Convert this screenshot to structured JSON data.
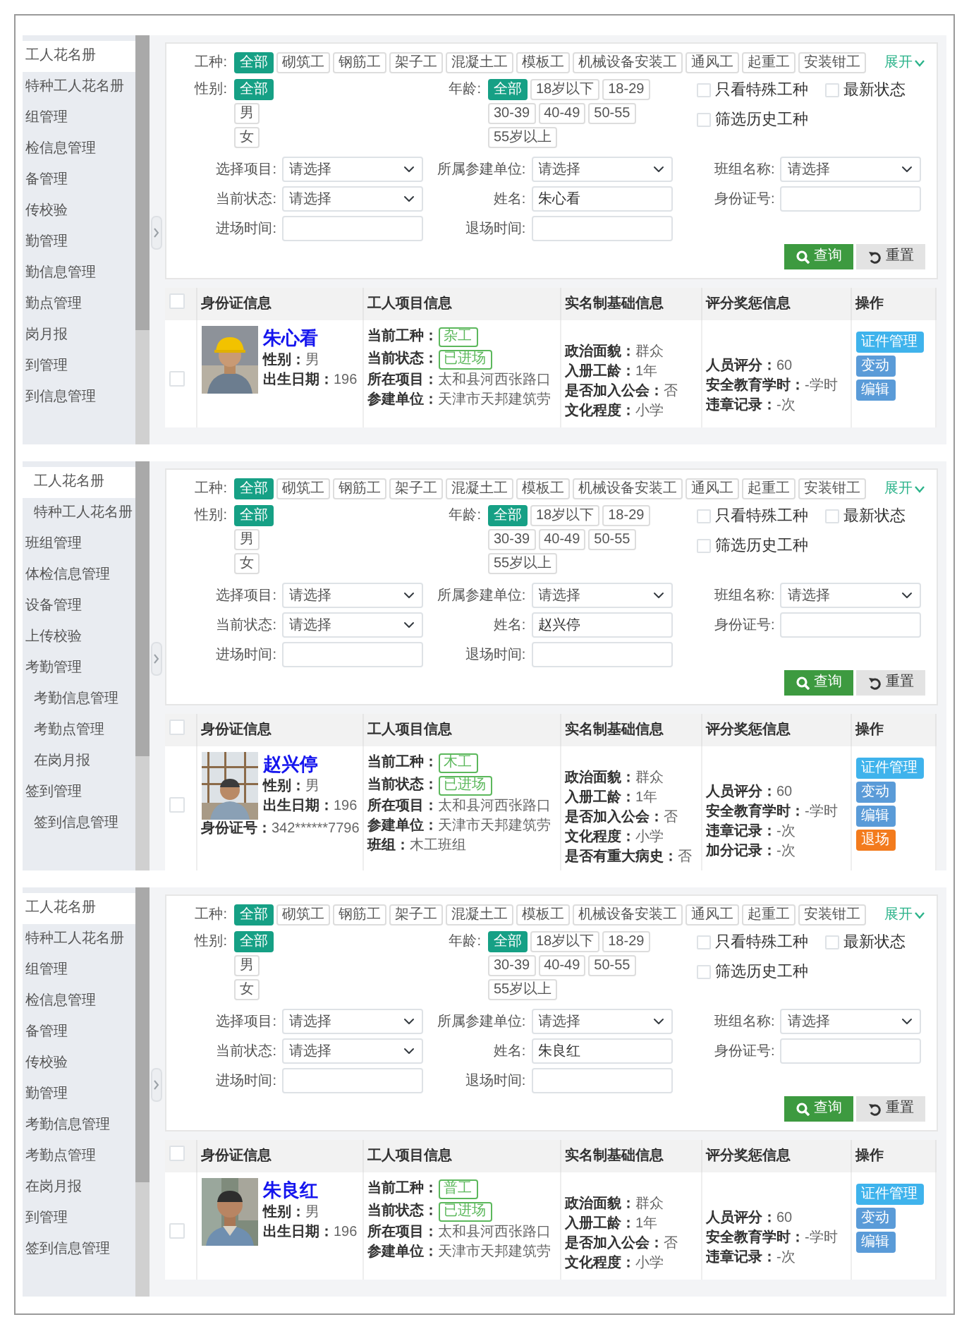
{
  "panels": [
    {
      "sidebar": {
        "items": [
          {
            "label": "工人花名册",
            "kind": "item",
            "selected": true
          },
          {
            "label": "特种工人花名册",
            "kind": "item",
            "selected": false
          },
          {
            "label": "组管理",
            "kind": "item",
            "selected": false
          },
          {
            "label": "检信息管理",
            "kind": "item",
            "selected": false
          },
          {
            "label": "备管理",
            "kind": "item",
            "selected": false
          },
          {
            "label": "传校验",
            "kind": "item",
            "selected": false
          },
          {
            "label": "勤管理",
            "kind": "item",
            "selected": false
          },
          {
            "label": "勤信息管理",
            "kind": "item",
            "selected": false
          },
          {
            "label": "勤点管理",
            "kind": "item",
            "selected": false
          },
          {
            "label": "岗月报",
            "kind": "item",
            "selected": false
          },
          {
            "label": "到管理",
            "kind": "item",
            "selected": false
          },
          {
            "label": "到信息管理",
            "kind": "item",
            "selected": false
          }
        ]
      },
      "filter": {
        "trade": {
          "label": "工种:",
          "options": [
            {
              "label": "全部",
              "selected": true
            },
            {
              "label": "砌筑工",
              "selected": false
            },
            {
              "label": "钢筋工",
              "selected": false
            },
            {
              "label": "架子工",
              "selected": false
            },
            {
              "label": "混凝土工",
              "selected": false
            },
            {
              "label": "模板工",
              "selected": false
            },
            {
              "label": "机械设备安装工",
              "selected": false
            },
            {
              "label": "通风工",
              "selected": false
            },
            {
              "label": "起重工",
              "selected": false
            },
            {
              "label": "安装钳工",
              "selected": false
            }
          ]
        },
        "expand": "展开",
        "gender": {
          "label": "性别:",
          "options": [
            {
              "label": "全部",
              "selected": true
            },
            {
              "label": "男",
              "selected": false
            },
            {
              "label": "女",
              "selected": false
            }
          ]
        },
        "age": {
          "label": "年龄:",
          "options": [
            {
              "label": "全部",
              "selected": true
            },
            {
              "label": "18岁以下",
              "selected": false
            },
            {
              "label": "18-29",
              "selected": false
            },
            {
              "label": "30-39",
              "selected": false
            },
            {
              "label": "40-49",
              "selected": false
            },
            {
              "label": "50-55",
              "selected": false
            },
            {
              "label": "55岁以上",
              "selected": false
            }
          ]
        },
        "checks": [
          {
            "label": "只看特殊工种",
            "checked": false
          },
          {
            "label": "最新状态",
            "checked": false
          },
          {
            "label": "筛选历史工种",
            "checked": false
          }
        ],
        "fields": [
          {
            "label": "选择项目:",
            "kind": "select",
            "value": "请选择"
          },
          {
            "label": "所属参建单位:",
            "kind": "select",
            "value": "请选择"
          },
          {
            "label": "班组名称:",
            "kind": "select",
            "value": "请选择"
          },
          {
            "label": "当前状态:",
            "kind": "select",
            "value": "请选择"
          },
          {
            "label": "姓名:",
            "kind": "input",
            "value": "朱心看"
          },
          {
            "label": "身份证号:",
            "kind": "input"
          },
          {
            "label": "进场时间:",
            "kind": "input"
          },
          {
            "label": "退场时间:",
            "kind": "input"
          }
        ],
        "buttons": [
          {
            "label": "查询",
            "kind": "search"
          },
          {
            "label": "重置",
            "kind": "reset"
          }
        ]
      },
      "table": {
        "header_checked": false,
        "columns": [
          "身份证信息",
          "工人项目信息",
          "实名制基础信息",
          "评分奖惩信息",
          "操作"
        ],
        "rows": [
          {
            "checked": false,
            "photo": {
              "kind": "picture"
            },
            "name": "朱心看",
            "details": [
              {
                "label": "性别：",
                "value": "男"
              },
              {
                "label": "出生日期：",
                "value": "196"
              }
            ],
            "project": [
              {
                "kind": "tag",
                "label": "当前工种：",
                "value": "杂工"
              },
              {
                "kind": "tag",
                "label": "当前状态：",
                "value": "已进场"
              },
              {
                "kind": "text",
                "label": "所在项目：",
                "value": "太和县河西张路口"
              },
              {
                "kind": "text",
                "label": "参建单位：",
                "value": "天津市天邦建筑劳"
              }
            ],
            "basic": [
              {
                "label": "政治面貌：",
                "value": "群众"
              },
              {
                "label": "入册工龄：",
                "value": "1年"
              },
              {
                "label": "是否加入公会：",
                "value": "否"
              },
              {
                "label": "文化程度：",
                "value": "小学"
              }
            ],
            "scores": [
              {
                "label": "人员评分：",
                "value": "60"
              },
              {
                "label": "安全教育学时：",
                "value": "-学时"
              },
              {
                "label": "违章记录：",
                "value": "-次"
              }
            ],
            "actions": [
              {
                "label": "证件管理",
                "kind": "info"
              },
              {
                "label": "变动",
                "kind": "primary"
              },
              {
                "label": "编辑",
                "kind": "primary"
              }
            ]
          }
        ]
      }
    },
    {
      "sidebar": {
        "items": [
          {
            "label": "工人花名册",
            "kind": "subitem",
            "selected": true
          },
          {
            "label": "特种工人花名册",
            "kind": "subitem",
            "selected": false
          },
          {
            "label": "班组管理",
            "kind": "item",
            "selected": false
          },
          {
            "label": "体检信息管理",
            "kind": "item",
            "selected": false
          },
          {
            "label": "设备管理",
            "kind": "item",
            "selected": false
          },
          {
            "label": "上传校验",
            "kind": "item",
            "selected": false
          },
          {
            "label": "考勤管理",
            "kind": "item",
            "selected": false
          },
          {
            "label": "考勤信息管理",
            "kind": "subitem",
            "selected": false
          },
          {
            "label": "考勤点管理",
            "kind": "subitem",
            "selected": false
          },
          {
            "label": "在岗月报",
            "kind": "subitem",
            "selected": false
          },
          {
            "label": "签到管理",
            "kind": "item",
            "selected": false
          },
          {
            "label": "签到信息管理",
            "kind": "subitem",
            "selected": false
          }
        ]
      },
      "filter": {
        "trade": {
          "label": "工种:",
          "options": [
            {
              "label": "全部",
              "selected": true
            },
            {
              "label": "砌筑工",
              "selected": false
            },
            {
              "label": "钢筋工",
              "selected": false
            },
            {
              "label": "架子工",
              "selected": false
            },
            {
              "label": "混凝土工",
              "selected": false
            },
            {
              "label": "模板工",
              "selected": false
            },
            {
              "label": "机械设备安装工",
              "selected": false
            },
            {
              "label": "通风工",
              "selected": false
            },
            {
              "label": "起重工",
              "selected": false
            },
            {
              "label": "安装钳工",
              "selected": false
            }
          ]
        },
        "expand": "展开",
        "gender": {
          "label": "性别:",
          "options": [
            {
              "label": "全部",
              "selected": true
            },
            {
              "label": "男",
              "selected": false
            },
            {
              "label": "女",
              "selected": false
            }
          ]
        },
        "age": {
          "label": "年龄:",
          "options": [
            {
              "label": "全部",
              "selected": true
            },
            {
              "label": "18岁以下",
              "selected": false
            },
            {
              "label": "18-29",
              "selected": false
            },
            {
              "label": "30-39",
              "selected": false
            },
            {
              "label": "40-49",
              "selected": false
            },
            {
              "label": "50-55",
              "selected": false
            },
            {
              "label": "55岁以上",
              "selected": false
            }
          ]
        },
        "checks": [
          {
            "label": "只看特殊工种",
            "checked": false
          },
          {
            "label": "最新状态",
            "checked": false
          },
          {
            "label": "筛选历史工种",
            "checked": false
          }
        ],
        "fields": [
          {
            "label": "选择项目:",
            "kind": "select",
            "value": "请选择"
          },
          {
            "label": "所属参建单位:",
            "kind": "select",
            "value": "请选择"
          },
          {
            "label": "班组名称:",
            "kind": "select",
            "value": "请选择"
          },
          {
            "label": "当前状态:",
            "kind": "select",
            "value": "请选择"
          },
          {
            "label": "姓名:",
            "kind": "input",
            "value": "赵兴停"
          },
          {
            "label": "身份证号:",
            "kind": "input"
          },
          {
            "label": "进场时间:",
            "kind": "input"
          },
          {
            "label": "退场时间:",
            "kind": "input"
          }
        ],
        "buttons": [
          {
            "label": "查询",
            "kind": "search"
          },
          {
            "label": "重置",
            "kind": "reset"
          }
        ]
      },
      "table": {
        "header_checked": false,
        "columns": [
          "身份证信息",
          "工人项目信息",
          "实名制基础信息",
          "评分奖惩信息",
          "操作"
        ],
        "rows": [
          {
            "checked": false,
            "photo": {
              "kind": "picture"
            },
            "name": "赵兴停",
            "details": [
              {
                "label": "性别：",
                "value": "男"
              },
              {
                "label": "出生日期：",
                "value": "196"
              }
            ],
            "below": [
              {
                "label": "身份证号：",
                "value": "342******7796"
              }
            ],
            "project": [
              {
                "kind": "tag",
                "label": "当前工种：",
                "value": "木工"
              },
              {
                "kind": "tag",
                "label": "当前状态：",
                "value": "已进场"
              },
              {
                "kind": "text",
                "label": "所在项目：",
                "value": "太和县河西张路口"
              },
              {
                "kind": "text",
                "label": "参建单位：",
                "value": "天津市天邦建筑劳"
              },
              {
                "kind": "text",
                "label": "班组：",
                "value": "木工班组"
              }
            ],
            "basic": [
              {
                "label": "政治面貌：",
                "value": "群众"
              },
              {
                "label": "入册工龄：",
                "value": "1年"
              },
              {
                "label": "是否加入公会：",
                "value": "否"
              },
              {
                "label": "文化程度：",
                "value": "小学"
              },
              {
                "label": "是否有重大病史：",
                "value": "否"
              }
            ],
            "scores": [
              {
                "label": "人员评分：",
                "value": "60"
              },
              {
                "label": "安全教育学时：",
                "value": "-学时"
              },
              {
                "label": "违章记录：",
                "value": "-次"
              },
              {
                "label": "加分记录：",
                "value": "-次"
              }
            ],
            "actions": [
              {
                "label": "证件管理",
                "kind": "info"
              },
              {
                "label": "变动",
                "kind": "primary"
              },
              {
                "label": "编辑",
                "kind": "primary"
              },
              {
                "label": "退场",
                "kind": "warning"
              }
            ]
          }
        ]
      }
    },
    {
      "sidebar": {
        "items": [
          {
            "label": "工人花名册",
            "kind": "item",
            "selected": true
          },
          {
            "label": "特种工人花名册",
            "kind": "item",
            "selected": false
          },
          {
            "label": "组管理",
            "kind": "item",
            "selected": false
          },
          {
            "label": "检信息管理",
            "kind": "item",
            "selected": false
          },
          {
            "label": "备管理",
            "kind": "item",
            "selected": false
          },
          {
            "label": "传校验",
            "kind": "item",
            "selected": false
          },
          {
            "label": "勤管理",
            "kind": "item",
            "selected": false
          },
          {
            "label": "考勤信息管理",
            "kind": "item",
            "selected": false
          },
          {
            "label": "考勤点管理",
            "kind": "item",
            "selected": false
          },
          {
            "label": "在岗月报",
            "kind": "item",
            "selected": false
          },
          {
            "label": "到管理",
            "kind": "item",
            "selected": false
          },
          {
            "label": "签到信息管理",
            "kind": "item",
            "selected": false
          }
        ]
      },
      "filter": {
        "trade": {
          "label": "工种:",
          "options": [
            {
              "label": "全部",
              "selected": true
            },
            {
              "label": "砌筑工",
              "selected": false
            },
            {
              "label": "钢筋工",
              "selected": false
            },
            {
              "label": "架子工",
              "selected": false
            },
            {
              "label": "混凝土工",
              "selected": false
            },
            {
              "label": "模板工",
              "selected": false
            },
            {
              "label": "机械设备安装工",
              "selected": false
            },
            {
              "label": "通风工",
              "selected": false
            },
            {
              "label": "起重工",
              "selected": false
            },
            {
              "label": "安装钳工",
              "selected": false
            }
          ]
        },
        "expand": "展开",
        "gender": {
          "label": "性别:",
          "options": [
            {
              "label": "全部",
              "selected": true
            },
            {
              "label": "男",
              "selected": false
            },
            {
              "label": "女",
              "selected": false
            }
          ]
        },
        "age": {
          "label": "年龄:",
          "options": [
            {
              "label": "全部",
              "selected": true
            },
            {
              "label": "18岁以下",
              "selected": false
            },
            {
              "label": "18-29",
              "selected": false
            },
            {
              "label": "30-39",
              "selected": false
            },
            {
              "label": "40-49",
              "selected": false
            },
            {
              "label": "50-55",
              "selected": false
            },
            {
              "label": "55岁以上",
              "selected": false
            }
          ]
        },
        "checks": [
          {
            "label": "只看特殊工种",
            "checked": false
          },
          {
            "label": "最新状态",
            "checked": false
          },
          {
            "label": "筛选历史工种",
            "checked": false
          }
        ],
        "fields": [
          {
            "label": "选择项目:",
            "kind": "select",
            "value": "请选择"
          },
          {
            "label": "所属参建单位:",
            "kind": "select",
            "value": "请选择"
          },
          {
            "label": "班组名称:",
            "kind": "select",
            "value": "请选择"
          },
          {
            "label": "当前状态:",
            "kind": "select",
            "value": "请选择"
          },
          {
            "label": "姓名:",
            "kind": "input",
            "value": "朱良红"
          },
          {
            "label": "身份证号:",
            "kind": "input"
          },
          {
            "label": "进场时间:",
            "kind": "input"
          },
          {
            "label": "退场时间:",
            "kind": "input"
          }
        ],
        "buttons": [
          {
            "label": "查询",
            "kind": "search"
          },
          {
            "label": "重置",
            "kind": "reset"
          }
        ]
      },
      "table": {
        "header_checked": false,
        "columns": [
          "身份证信息",
          "工人项目信息",
          "实名制基础信息",
          "评分奖惩信息",
          "操作"
        ],
        "rows": [
          {
            "checked": false,
            "photo": {
              "kind": "picture"
            },
            "name": "朱良红",
            "details": [
              {
                "label": "性别：",
                "value": "男"
              },
              {
                "label": "出生日期：",
                "value": "196"
              }
            ],
            "project": [
              {
                "kind": "tag",
                "label": "当前工种：",
                "value": "普工"
              },
              {
                "kind": "tag",
                "label": "当前状态：",
                "value": "已进场"
              },
              {
                "kind": "text",
                "label": "所在项目：",
                "value": "太和县河西张路口"
              },
              {
                "kind": "text",
                "label": "参建单位：",
                "value": "天津市天邦建筑劳"
              }
            ],
            "basic": [
              {
                "label": "政治面貌：",
                "value": "群众"
              },
              {
                "label": "入册工龄：",
                "value": "1年"
              },
              {
                "label": "是否加入公会：",
                "value": "否"
              },
              {
                "label": "文化程度：",
                "value": "小学"
              }
            ],
            "scores": [
              {
                "label": "人员评分：",
                "value": "60"
              },
              {
                "label": "安全教育学时：",
                "value": "-学时"
              },
              {
                "label": "违章记录：",
                "value": "-次"
              }
            ],
            "actions": [
              {
                "label": "证件管理",
                "kind": "info"
              },
              {
                "label": "变动",
                "kind": "primary"
              },
              {
                "label": "编辑",
                "kind": "primary"
              }
            ]
          }
        ]
      }
    }
  ]
}
